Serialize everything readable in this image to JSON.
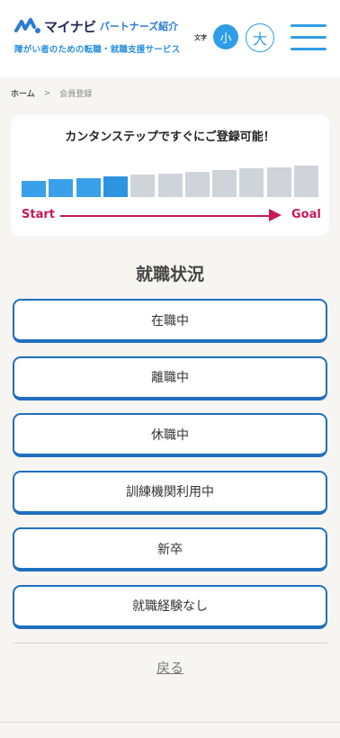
{
  "header": {
    "brand": "マイナビ",
    "brand_sub": "パートナーズ紹介",
    "tagline": "障がい者のための転職・就職支援サービス",
    "font_size_label": "文字",
    "font_small": "小",
    "font_large": "大"
  },
  "breadcrumb": {
    "home": "ホーム",
    "separator": ">",
    "current": "会員登録"
  },
  "progress": {
    "title": "カンタンステップですぐにご登録可能！",
    "total_steps": 11,
    "completed_steps": 4,
    "start_label": "Start",
    "goal_label": "Goal",
    "colors": {
      "completed": "#3aa0ea",
      "pending": "#cfd3da",
      "arrow": "#c8185a"
    }
  },
  "section": {
    "heading": "就職状況"
  },
  "options": [
    {
      "label": "在職中"
    },
    {
      "label": "離職中"
    },
    {
      "label": "休職中"
    },
    {
      "label": "訓練機関利用中"
    },
    {
      "label": "新卒"
    },
    {
      "label": "就職経験なし"
    }
  ],
  "back_label": "戻る"
}
